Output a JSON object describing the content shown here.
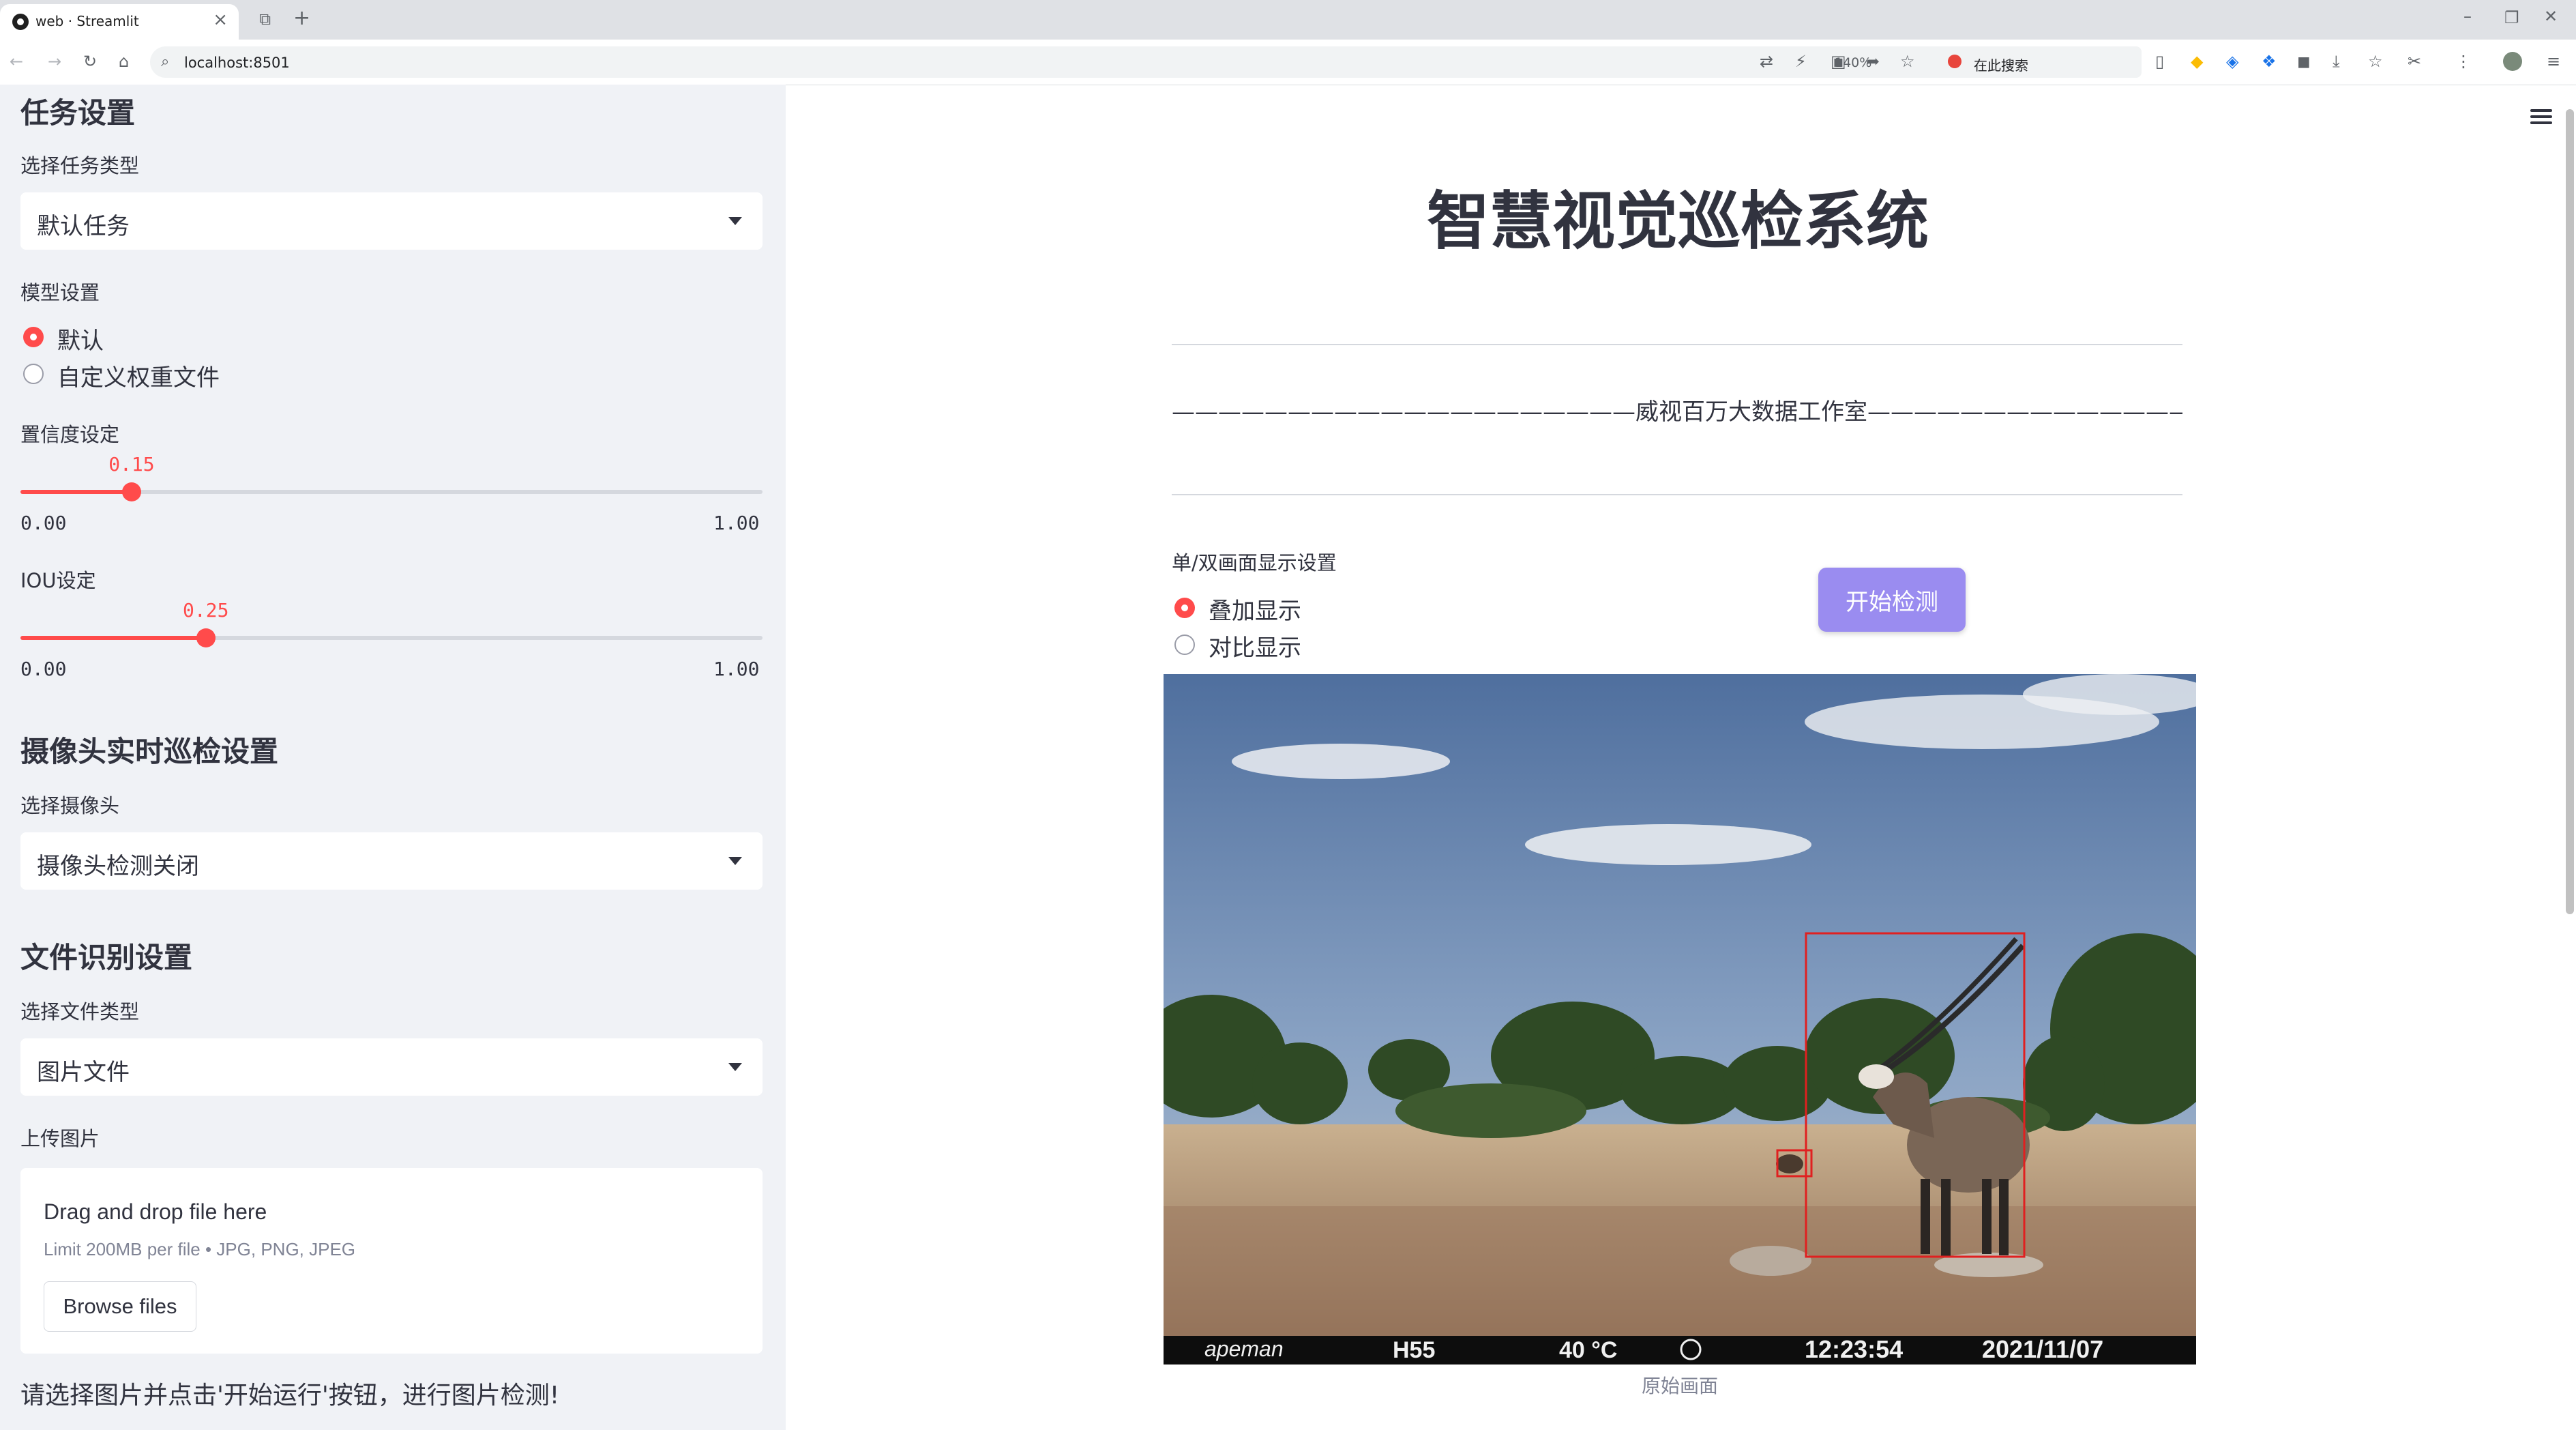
{
  "browser": {
    "tab_title": "web · Streamlit",
    "url": "localhost:8501",
    "zoom": "140%",
    "search_placeholder": "在此搜索"
  },
  "sidebar": {
    "task_section": {
      "heading": "任务设置",
      "task_type_label": "选择任务类型",
      "task_type_value": "默认任务"
    },
    "model_section": {
      "label": "模型设置",
      "options": [
        "默认",
        "自定义权重文件"
      ],
      "selected": "默认"
    },
    "confidence": {
      "label": "置信度设定",
      "value": "0.15",
      "value_num": 0.15,
      "min": "0.00",
      "max": "1.00"
    },
    "iou": {
      "label": "IOU设定",
      "value": "0.25",
      "value_num": 0.25,
      "min": "0.00",
      "max": "1.00"
    },
    "camera_section": {
      "heading": "摄像头实时巡检设置",
      "label": "选择摄像头",
      "value": "摄像头检测关闭"
    },
    "file_section": {
      "heading": "文件识别设置",
      "type_label": "选择文件类型",
      "type_value": "图片文件",
      "upload_label": "上传图片",
      "drop_text": "Drag and drop file here",
      "limit_text": "Limit 200MB per file • JPG, PNG, JPEG",
      "browse_label": "Browse files"
    },
    "hint": "请选择图片并点击'开始运行'按钮，进行图片检测!"
  },
  "main": {
    "title": "智慧视觉巡检系统",
    "banner": "————————————————————威视百万大数据工作室———————————————————————",
    "display_mode": {
      "label": "单/双画面显示设置",
      "options": [
        "叠加显示",
        "对比显示"
      ],
      "selected": "叠加显示"
    },
    "start_button": "开始检测",
    "image_caption": "原始画面",
    "camera_overlay": {
      "brand": "apeman",
      "model": "H55",
      "temperature": "40 °C",
      "time": "12:23:54",
      "date": "2021/11/07"
    }
  },
  "colors": {
    "accent": "#ff4b4b",
    "button": "#9a8cf0",
    "sidebar_bg": "#f0f2f6",
    "detection_box": "#e02020"
  }
}
